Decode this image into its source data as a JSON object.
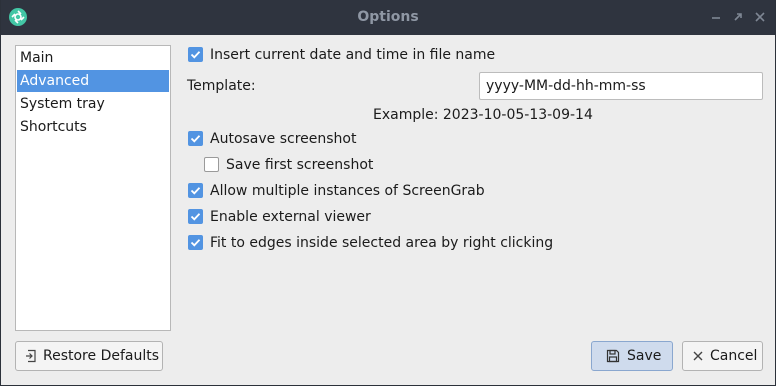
{
  "window": {
    "title": "Options",
    "controls": [
      "minimize",
      "restore",
      "close"
    ]
  },
  "sidebar": {
    "items": [
      {
        "label": "Main",
        "selected": false
      },
      {
        "label": "Advanced",
        "selected": true
      },
      {
        "label": "System tray",
        "selected": false
      },
      {
        "label": "Shortcuts",
        "selected": false
      }
    ]
  },
  "advanced": {
    "insert_datetime": {
      "label": "Insert current date and time in file name",
      "checked": true
    },
    "template_label": "Template:",
    "template_value": "yyyy-MM-dd-hh-mm-ss",
    "example": "Example: 2023-10-05-13-09-14",
    "autosave": {
      "label": "Autosave screenshot",
      "checked": true
    },
    "save_first": {
      "label": "Save first screenshot",
      "checked": false
    },
    "multiple_instances": {
      "label": "Allow multiple instances of ScreenGrab",
      "checked": true
    },
    "external_viewer": {
      "label": "Enable external viewer",
      "checked": true
    },
    "fit_edges": {
      "label": "Fit to edges inside selected area by right clicking",
      "checked": true
    }
  },
  "buttons": {
    "restore_defaults": "Restore Defaults",
    "save": "Save",
    "cancel": "Cancel"
  },
  "colors": {
    "accent": "#5294e2",
    "titlebar": "#2f343f",
    "app_icon": "#43c6a5"
  }
}
